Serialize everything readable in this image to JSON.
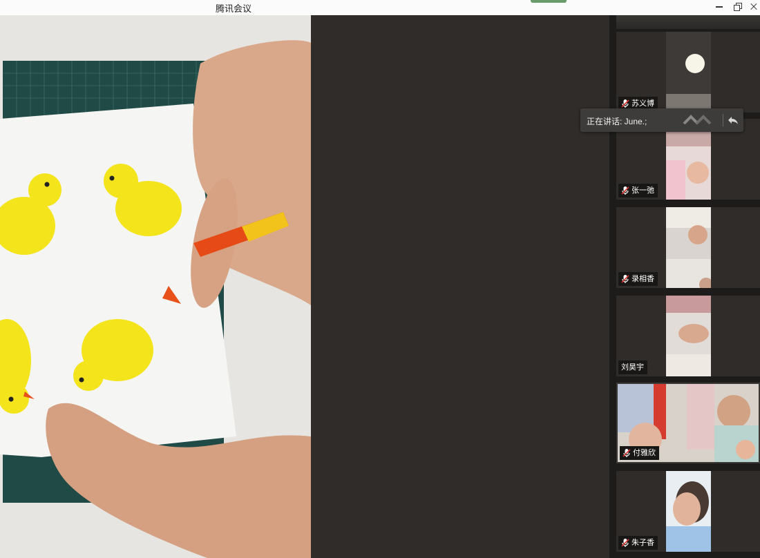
{
  "window": {
    "title": "腾讯会议"
  },
  "speaking": {
    "label": "正在讲话: June.;"
  },
  "participants": [
    {
      "name": "苏义博",
      "muted": true
    },
    {
      "name": "张一弛",
      "muted": true
    },
    {
      "name": "录相香",
      "muted": true
    },
    {
      "name": "刘昊宇",
      "muted": false
    },
    {
      "name": "付雅欣",
      "muted": true
    },
    {
      "name": "朱子香",
      "muted": true
    }
  ],
  "icons": {
    "minimize": "minimize-icon",
    "restore": "restore-icon",
    "close": "close-icon",
    "mic_muted": "mic-muted-icon",
    "collapse": "collapse-icon",
    "back": "back-icon"
  },
  "colors": {
    "panel_bg": "#2f2c29",
    "badge_bg": "#181716",
    "mic_muted": "#d9322f"
  }
}
